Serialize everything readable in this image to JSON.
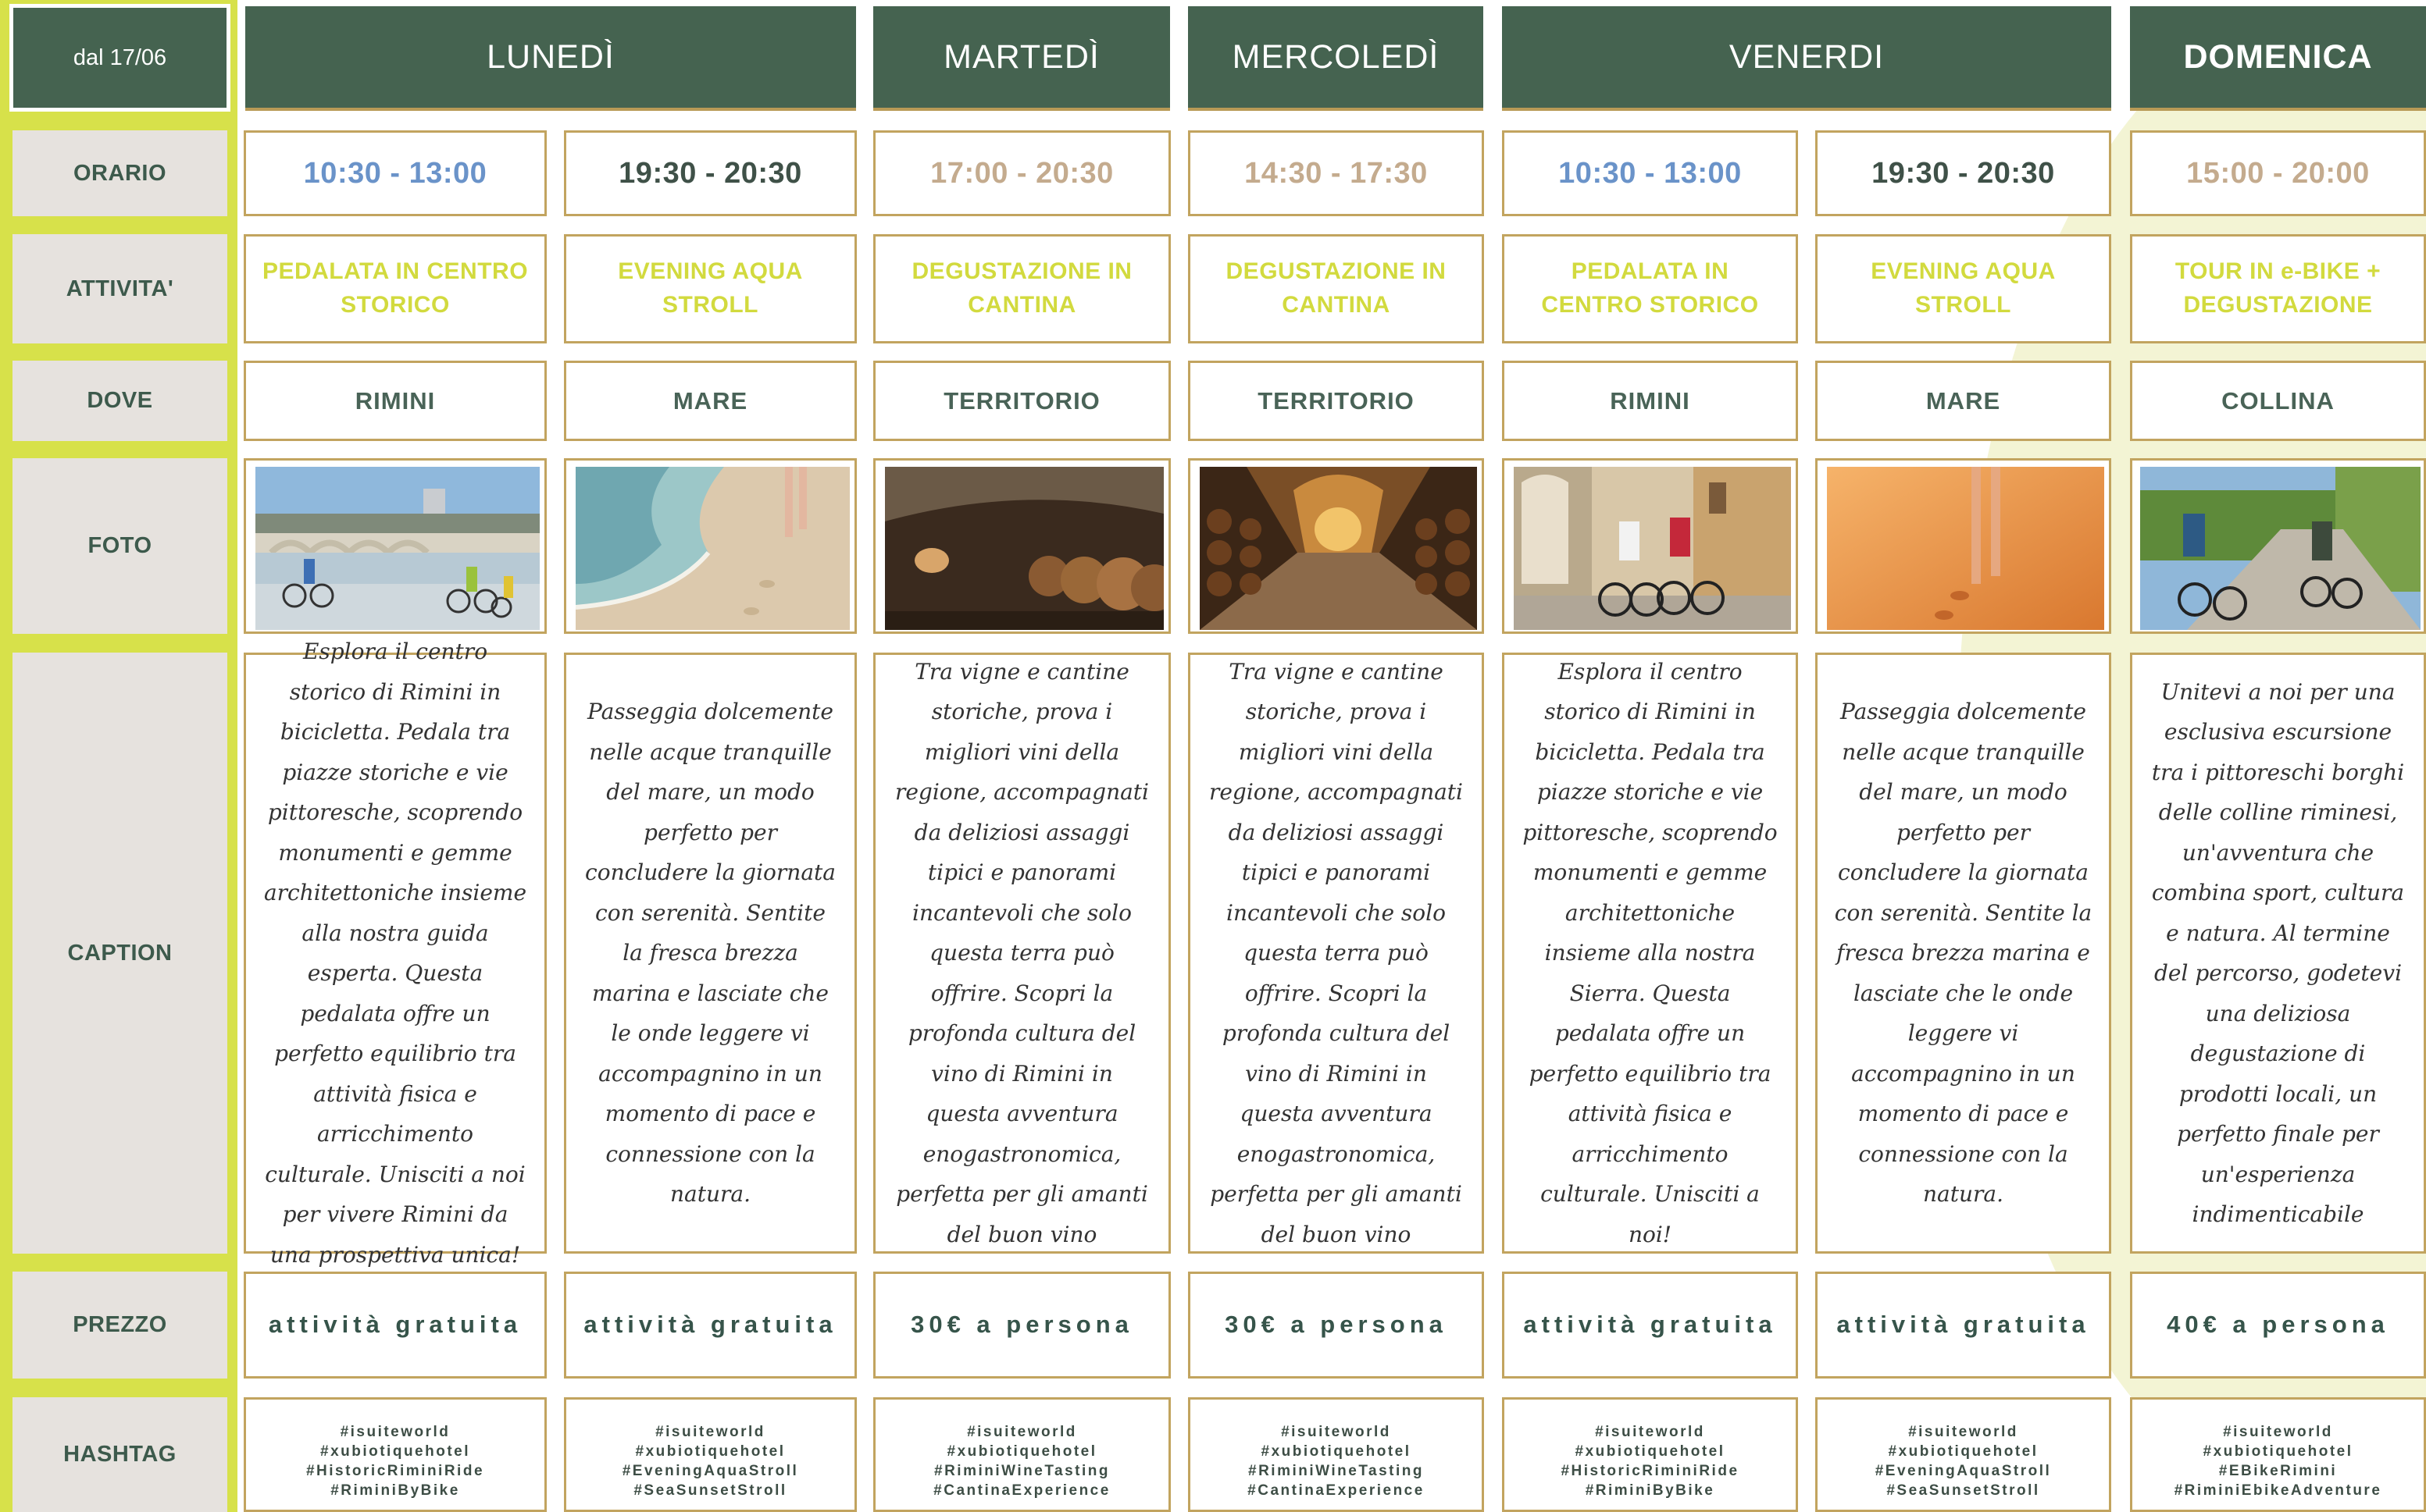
{
  "header": {
    "corner_label": "dal 17/06",
    "days": [
      "LUNEDÌ",
      "MARTEDÌ",
      "MERCOLEDÌ",
      "VENERDI",
      "DOMENICA"
    ]
  },
  "row_labels": {
    "orario": "ORARIO",
    "attivita": "ATTIVITA'",
    "dove": "DOVE",
    "foto": "FOTO",
    "caption": "CAPTION",
    "prezzo": "PREZZO",
    "hashtag": "HASHTAG"
  },
  "columns": [
    {
      "time": "10:30 - 13:00",
      "time_color": "#6a93c9",
      "activity": "PEDALATA IN CENTRO STORICO",
      "where": "RIMINI",
      "photo": "bike-tour-rimini-bridge-photo",
      "caption": "Esplora il centro storico di Rimini in bicicletta. Pedala tra piazze storiche e vie pittoresche, scoprendo monumenti e gemme architettoniche insieme alla nostra guida esperta. Questa pedalata offre un perfetto equilibrio tra attività fisica e arricchimento culturale. Unisciti a noi per vivere Rimini da una prospettiva unica!",
      "price": "attività gratuita",
      "hashtags": [
        "#isuiteworld",
        "#xubiotiquehotel",
        "#HistoricRiminiRide",
        "#RiminiByBike"
      ]
    },
    {
      "time": "19:30 - 20:30",
      "time_color": "#3f5148",
      "activity": "EVENING AQUA STROLL",
      "where": "MARE",
      "photo": "sea-walk-photo",
      "caption": "Passeggia dolcemente nelle acque tranquille del mare, un modo perfetto per concludere la giornata con serenità. Sentite la fresca brezza marina e lasciate che le onde leggere vi accompagnino in un momento di pace e connessione con la natura.",
      "price": "attività gratuita",
      "hashtags": [
        "#isuiteworld",
        "#xubiotiquehotel",
        "#EveningAquaStroll",
        "#SeaSunsetStroll"
      ]
    },
    {
      "time": "17:00 - 20:30",
      "time_color": "#c4ab8e",
      "activity": "DEGUSTAZIONE IN CANTINA",
      "where": "TERRITORIO",
      "photo": "wine-cellar-photo",
      "caption": "Tra vigne e cantine storiche, prova i migliori vini della regione, accompagnati da deliziosi assaggi tipici e panorami incantevoli che solo questa terra può offrire. Scopri la profonda cultura del vino di Rimini in questa avventura enogastronomica, perfetta per gli amanti del buon vino",
      "price": "30€ a persona",
      "hashtags": [
        "#isuiteworld",
        "#xubiotiquehotel",
        "#RiminiWineTasting",
        "#CantinaExperience"
      ]
    },
    {
      "time": "14:30 - 17:30",
      "time_color": "#c4ab8e",
      "activity": "DEGUSTAZIONE IN CANTINA",
      "where": "TERRITORIO",
      "photo": "wine-cellar-corridor-photo",
      "caption": "Tra vigne e cantine storiche, prova i migliori vini della regione, accompagnati da deliziosi assaggi tipici e panorami incantevoli che solo questa terra può offrire. Scopri la profonda cultura del vino di Rimini in questa avventura enogastronomica, perfetta per gli amanti del buon vino",
      "price": "30€ a persona",
      "hashtags": [
        "#isuiteworld",
        "#xubiotiquehotel",
        "#RiminiWineTasting",
        "#CantinaExperience"
      ]
    },
    {
      "time": "10:30 - 13:00",
      "time_color": "#6a93c9",
      "activity": "PEDALATA IN CENTRO STORICO",
      "where": "RIMINI",
      "photo": "bike-couple-portico-photo",
      "caption": "Esplora il centro storico di Rimini in bicicletta. Pedala tra piazze storiche e vie pittoresche, scoprendo monumenti e gemme architettoniche insieme alla nostra Sierra. Questa pedalata offre un perfetto equilibrio tra attività fisica e arricchimento culturale. Unisciti a noi!",
      "price": "attività gratuita",
      "hashtags": [
        "#isuiteworld",
        "#xubiotiquehotel",
        "#HistoricRiminiRide",
        "#RiminiByBike"
      ]
    },
    {
      "time": "19:30 - 20:30",
      "time_color": "#3f5148",
      "activity": "EVENING AQUA STROLL",
      "where": "MARE",
      "photo": "sunset-beach-walk-photo",
      "caption": "Passeggia dolcemente nelle acque tranquille del mare, un modo perfetto per concludere la giornata con serenità. Sentite la fresca brezza marina e lasciate che le onde leggere vi accompagnino in un momento di pace e connessione con la natura.",
      "price": "attività gratuita",
      "hashtags": [
        "#isuiteworld",
        "#xubiotiquehotel",
        "#EveningAquaStroll",
        "#SeaSunsetStroll"
      ]
    },
    {
      "time": "15:00 - 20:00",
      "time_color": "#c4ab8e",
      "activity": "TOUR IN e-BIKE + DEGUSTAZIONE",
      "where": "COLLINA",
      "photo": "ebike-hill-photo",
      "caption": "Unitevi a noi per una esclusiva escursione tra i pittoreschi borghi delle colline riminesi, un'avventura che combina sport, cultura e natura. Al termine del percorso, godetevi una deliziosa degustazione di prodotti locali, un perfetto finale per un'esperienza indimenticabile",
      "price": "40€ a persona",
      "hashtags": [
        "#isuiteworld",
        "#xubiotiquehotel",
        "#EBikeRimini",
        "#RiminiEbikeAdventure"
      ]
    }
  ]
}
